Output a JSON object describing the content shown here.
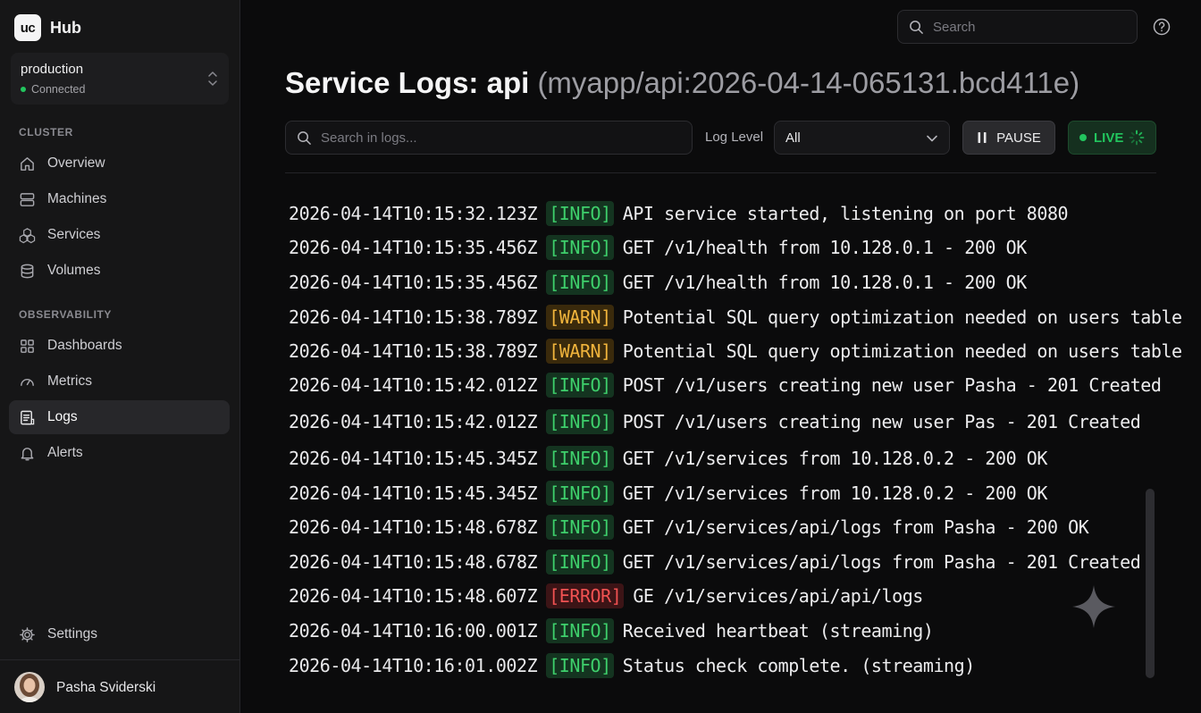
{
  "app": {
    "logo_text": "uc",
    "name": "Hub"
  },
  "environment": {
    "name": "production",
    "status": "Connected"
  },
  "sidebar": {
    "cluster_label": "CLUSTER",
    "cluster_items": [
      {
        "label": "Overview",
        "icon": "home-icon"
      },
      {
        "label": "Machines",
        "icon": "server-icon"
      },
      {
        "label": "Services",
        "icon": "services-icon"
      },
      {
        "label": "Volumes",
        "icon": "database-icon"
      }
    ],
    "observability_label": "OBSERVABILITY",
    "observability_items": [
      {
        "label": "Dashboards",
        "icon": "grid-icon"
      },
      {
        "label": "Metrics",
        "icon": "gauge-icon"
      },
      {
        "label": "Logs",
        "icon": "logs-icon",
        "active": true
      },
      {
        "label": "Alerts",
        "icon": "bell-icon"
      }
    ],
    "settings_label": "Settings"
  },
  "user": {
    "name": "Pasha Sviderski"
  },
  "topbar": {
    "search_placeholder": "Search"
  },
  "page": {
    "title": "Service Logs: api",
    "subtitle": "(myapp/api:2026-04-14-065131.bcd411e)"
  },
  "toolbar": {
    "log_search_placeholder": "Search in logs...",
    "level_label": "Log Level",
    "level_value": "All",
    "pause_label": "PAUSE",
    "live_label": "LIVE"
  },
  "colors": {
    "info": "#3ecf6b",
    "warn": "#f0b43c",
    "error": "#f05252",
    "live": "#22c55e"
  },
  "logs": [
    {
      "ts": "2026-04-14T10:15:32.123Z",
      "level": "[INFO]",
      "kind": "info",
      "msg": "API service started, listening on port 8080"
    },
    {
      "ts": "2026-04-14T10:15:35.456Z",
      "level": "[INFO]",
      "kind": "info",
      "msg": "GET /v1/health from 10.128.0.1 - 200 OK"
    },
    {
      "ts": "2026-04-14T10:15:35.456Z",
      "level": "[INFO]",
      "kind": "info",
      "msg": "GET /v1/health from 10.128.0.1 - 200 OK"
    },
    {
      "ts": "2026-04-14T10:15:38.789Z",
      "level": "[WARN]",
      "kind": "warn",
      "msg": "Potential SQL query optimization needed on users table"
    },
    {
      "ts": "2026-04-14T10:15:38.789Z",
      "level": "[WARN]",
      "kind": "warn",
      "msg": "Potential SQL query optimization needed on users table"
    },
    {
      "ts": "2026-04-14T10:15:42.012Z",
      "level": "[INFO]",
      "kind": "info",
      "msg": "POST /v1/users creating new user Pasha - 201 Created"
    },
    {
      "ts": "2026-04-14T10:15:42.012Z",
      "level": "[INFO]",
      "kind": "info",
      "msg": "POST /v1/users creating new user Pas - 201 Created"
    },
    {
      "ts": "2026-04-14T10:15:45.345Z",
      "level": "[INFO]",
      "kind": "info",
      "msg": "GET /v1/services from 10.128.0.2 - 200 OK"
    },
    {
      "ts": "2026-04-14T10:15:45.345Z",
      "level": "[INFO]",
      "kind": "info",
      "msg": "GET /v1/services from 10.128.0.2 - 200 OK"
    },
    {
      "ts": "2026-04-14T10:15:48.678Z",
      "level": "[INFO]",
      "kind": "info",
      "msg": "GET /v1/services/api/logs from Pasha - 200 OK"
    },
    {
      "ts": "2026-04-14T10:15:48.678Z",
      "level": "[INFO]",
      "kind": "info",
      "msg": "GET /v1/services/api/logs from Pasha - 201 Created"
    },
    {
      "ts": "2026-04-14T10:15:48.607Z",
      "level": "[ERROR]",
      "kind": "error",
      "msg": "GE /v1/services/api/api/logs"
    },
    {
      "ts": "2026-04-14T10:16:00.001Z",
      "level": "[INFO]",
      "kind": "info",
      "msg": "Received heartbeat (streaming)"
    },
    {
      "ts": "2026-04-14T10:16:01.002Z",
      "level": "[INFO]",
      "kind": "info",
      "msg": "Status check complete. (streaming)"
    }
  ]
}
